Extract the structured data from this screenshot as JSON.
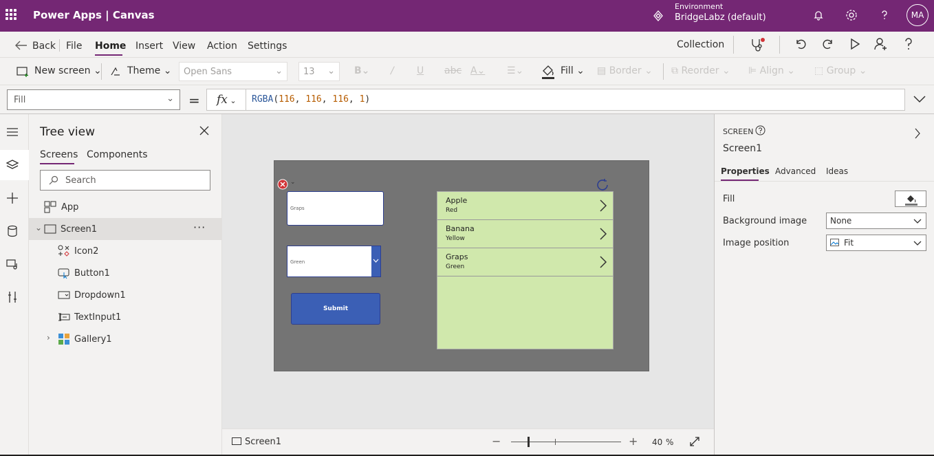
{
  "header": {
    "app_title": "Power Apps  |  Canvas",
    "environment_label": "Environment",
    "environment_name": "BridgeLabz (default)",
    "user_initials": "MA"
  },
  "menu": {
    "back": "Back",
    "items": [
      "File",
      "Home",
      "Insert",
      "View",
      "Action",
      "Settings"
    ],
    "active": "Home",
    "collection": "Collection"
  },
  "toolbar": {
    "new_screen": "New screen",
    "theme": "Theme",
    "font": "Open Sans",
    "font_size": "13",
    "fill": "Fill",
    "border": "Border",
    "reorder": "Reorder",
    "align": "Align",
    "group": "Group"
  },
  "formula_bar": {
    "property": "Fill",
    "equals": "=",
    "fx": "fx",
    "formula_fn": "RGBA",
    "formula_args": [
      "116",
      "116",
      "116",
      "1"
    ]
  },
  "tree_view": {
    "title": "Tree view",
    "tabs": [
      "Screens",
      "Components"
    ],
    "search_placeholder": "Search",
    "app_label": "App",
    "screen_label": "Screen1",
    "children": [
      "Icon2",
      "Button1",
      "Dropdown1",
      "TextInput1",
      "Gallery1"
    ]
  },
  "canvas": {
    "text_input_value": "Graps",
    "dropdown_value": "Green",
    "button_label": "Submit",
    "gallery_items": [
      {
        "title": "Apple",
        "subtitle": "Red"
      },
      {
        "title": "Banana",
        "subtitle": "Yellow"
      },
      {
        "title": "Graps",
        "subtitle": "Green"
      }
    ],
    "screen_fill": "#747474",
    "gallery_fill": "#d0e8ac"
  },
  "status_bar": {
    "screen_name": "Screen1",
    "zoom_value": "40",
    "zoom_unit": "%",
    "zoom_level": 0.4
  },
  "properties_panel": {
    "kind": "SCREEN",
    "name": "Screen1",
    "tabs": [
      "Properties",
      "Advanced",
      "Ideas"
    ],
    "fill_label": "Fill",
    "background_image_label": "Background image",
    "background_image_value": "None",
    "image_position_label": "Image position",
    "image_position_value": "Fit"
  },
  "colors": {
    "brand": "#742774",
    "control_blue": "#3b5fb5"
  }
}
